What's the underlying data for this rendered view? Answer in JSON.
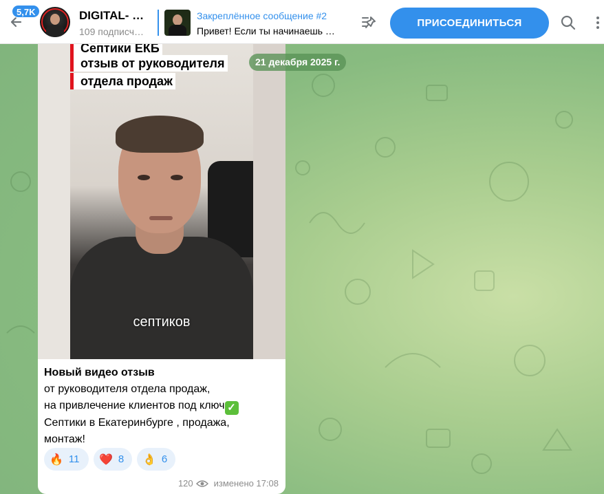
{
  "header": {
    "back_label": "Назад",
    "unread_count": "5,7K",
    "channel_title": "DIGITAL- …",
    "channel_subtitle": "109 подписч…",
    "pinned": {
      "title": "Закреплённое сообщение #2",
      "text": "Привет! Если ты начинаешь …"
    },
    "join_label": "ПРИСОЕДИНИТЬСЯ"
  },
  "message": {
    "date_chip": "21 декабря 2025 г.",
    "video": {
      "overlay_lines": [
        "Септики ЕКБ",
        "отзыв от руководителя",
        "отдела продаж"
      ],
      "caption": "септиков"
    },
    "text_lines": [
      "Новый видео отзыв",
      "от руководителя отдела продаж,",
      "на привлечение клиентов под ключ",
      " Септики в Екатеринбурге , продажа,",
      "монтаж!"
    ],
    "reactions": [
      {
        "emoji": "🔥",
        "count": "11"
      },
      {
        "emoji": "❤️",
        "count": "8"
      },
      {
        "emoji": "👌",
        "count": "6"
      }
    ],
    "views": "120",
    "edited_time": "изменено 17:08"
  },
  "colors": {
    "accent": "#3390ec",
    "chat_background": "#8fbf80",
    "overlay_bar": "#e0141e"
  }
}
